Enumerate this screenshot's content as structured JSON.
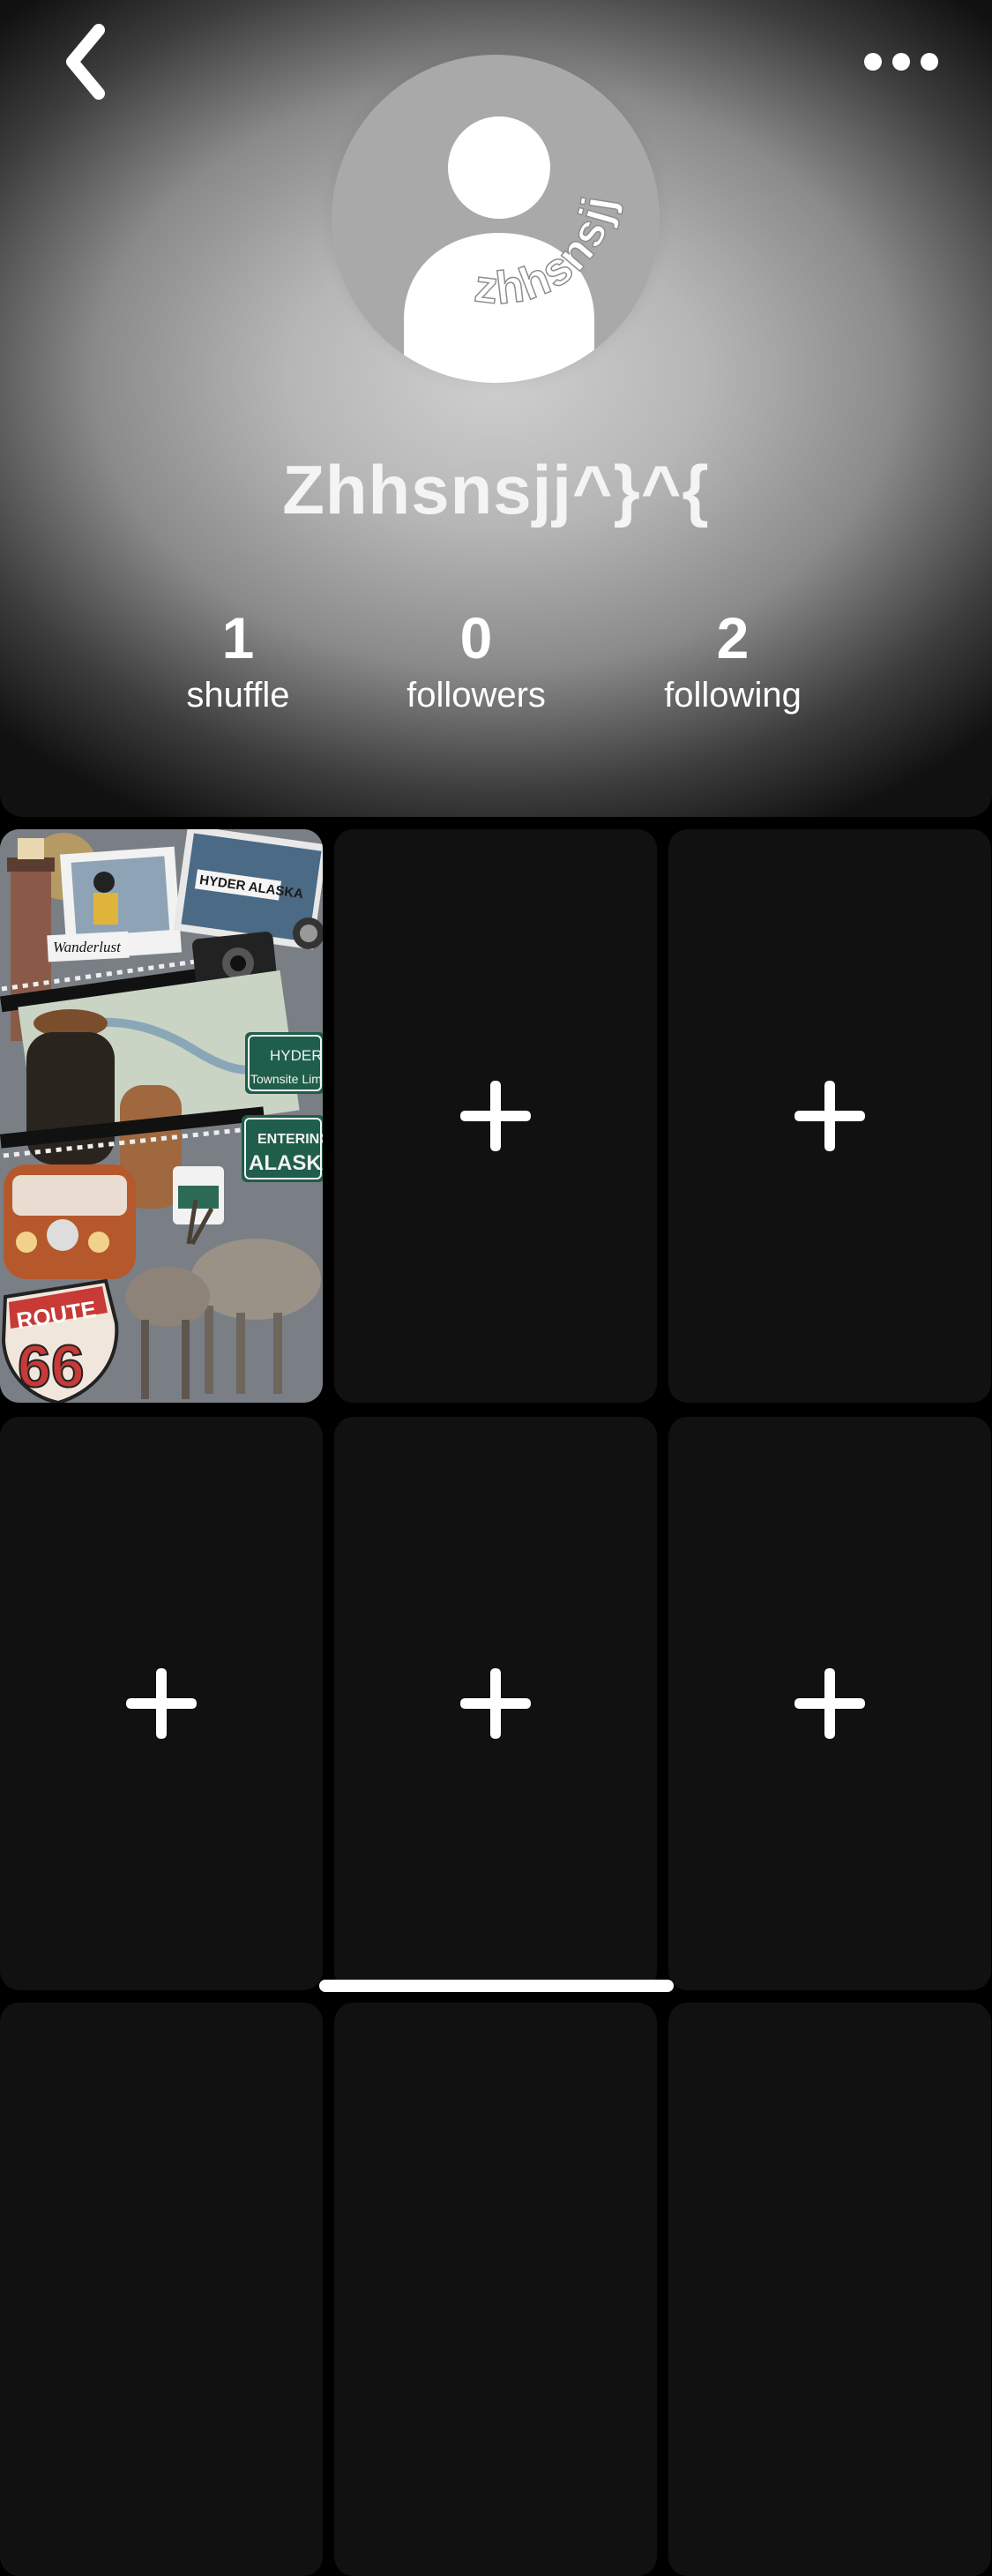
{
  "header": {
    "avatar_ring_text": "zhhsnsjj",
    "display_name": "Zhhsnsjj^}^{"
  },
  "stats": [
    {
      "value": "1",
      "label": "shuffle"
    },
    {
      "value": "0",
      "label": "followers"
    },
    {
      "value": "2",
      "label": "following"
    }
  ],
  "collage_texts": {
    "wanderlust": "Wanderlust",
    "hyder_alaska": "HYDER ALASKA",
    "sign_hyder": "HYDER",
    "sign_townsite": "Townsite Lim",
    "sign_entering": "ENTERING",
    "sign_alaska": "ALASKA",
    "route": "ROUTE",
    "route_number": "66"
  },
  "icons": {
    "back": "chevron-left-icon",
    "more": "more-horizontal-icon",
    "add": "plus-sparkle-icon"
  },
  "colors": {
    "tile_bg": "#111111",
    "page_bg": "#000000",
    "text": "#ffffff"
  }
}
